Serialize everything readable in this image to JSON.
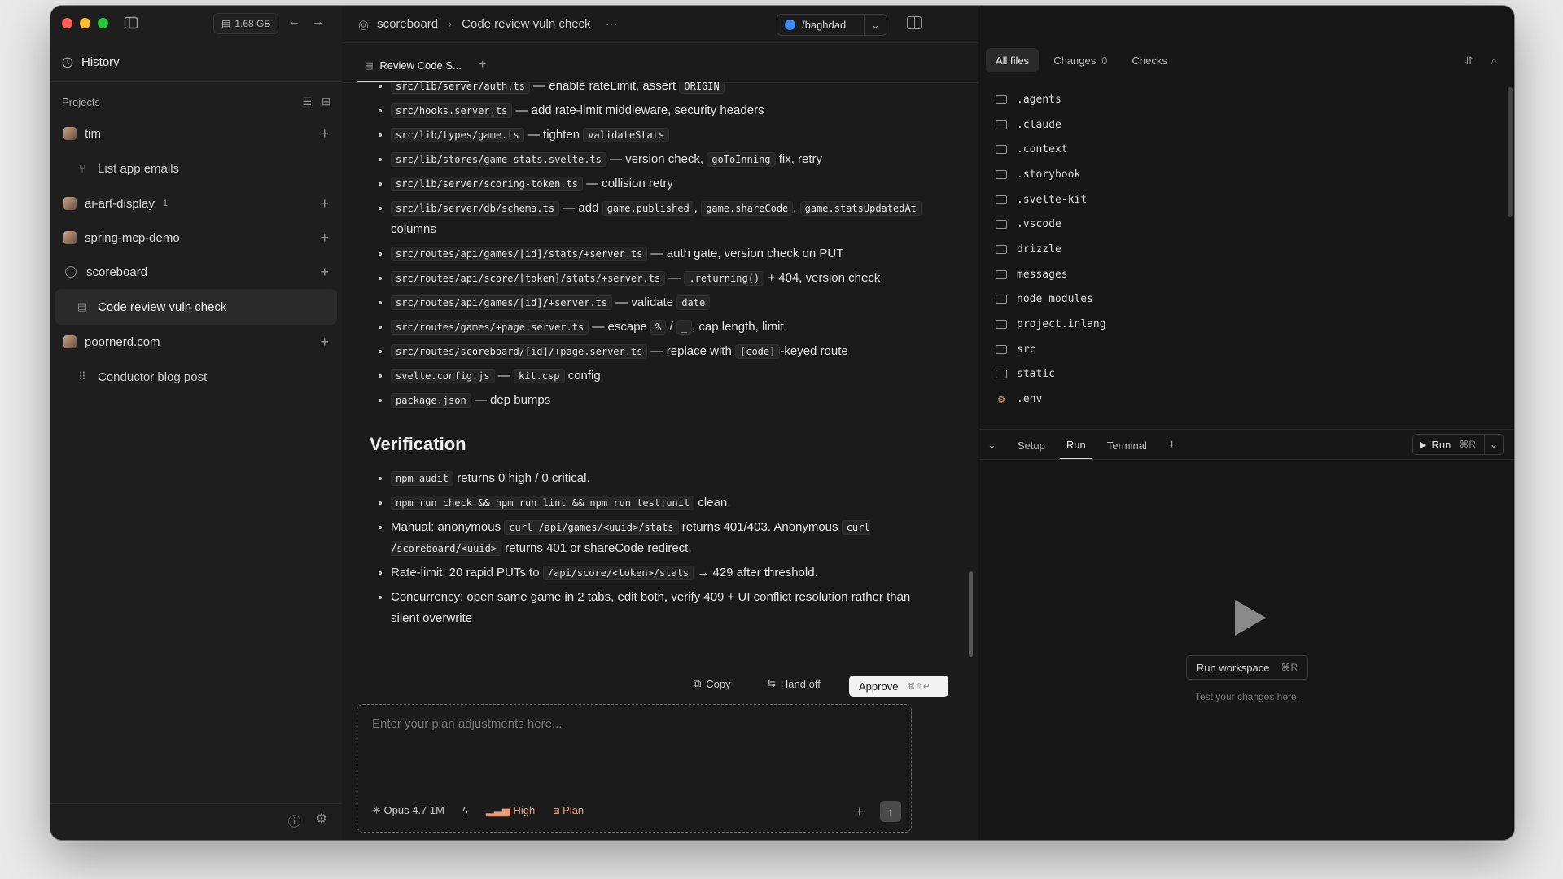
{
  "sidebar": {
    "memory": "1.68 GB",
    "history_label": "History",
    "projects_label": "Projects",
    "projects": [
      {
        "name": "tim",
        "badge": "",
        "children": [
          {
            "label": "List app emails",
            "icon": "branch-icon"
          }
        ]
      },
      {
        "name": "ai-art-display",
        "badge": "1",
        "children": []
      },
      {
        "name": "spring-mcp-demo",
        "badge": "",
        "children": []
      },
      {
        "name": "scoreboard",
        "badge": "",
        "children": [
          {
            "label": "Code review vuln check",
            "icon": "doc-icon",
            "active": true
          }
        ]
      },
      {
        "name": "poornerd.com",
        "badge": "",
        "children": [
          {
            "label": "Conductor blog post",
            "icon": "grid-icon"
          }
        ]
      }
    ]
  },
  "header": {
    "project": "scoreboard",
    "title": "Code review vuln check",
    "branch": "/baghdad"
  },
  "tab": {
    "label": "Review Code S..."
  },
  "plan": {
    "file_items": [
      {
        "code": [
          "src/lib/server/auth.ts",
          "ORIGIN"
        ],
        "text": [
          "— enable rateLimit, assert"
        ]
      },
      {
        "code": [
          "src/hooks.server.ts"
        ],
        "text": [
          "— add rate-limit middleware, security headers"
        ]
      },
      {
        "code": [
          "src/lib/types/game.ts",
          "validateStats"
        ],
        "text": [
          "— tighten"
        ]
      },
      {
        "code": [
          "src/lib/stores/game-stats.svelte.ts",
          "goToInning"
        ],
        "text": [
          "— version check,",
          "fix, retry"
        ]
      },
      {
        "code": [
          "src/lib/server/scoring-token.ts"
        ],
        "text": [
          "— collision retry"
        ]
      },
      {
        "code": [
          "src/lib/server/db/schema.ts",
          "game.published",
          "game.shareCode",
          "game.statsUpdatedAt"
        ],
        "text": [
          "— add",
          ",",
          ",",
          "columns"
        ]
      },
      {
        "code": [
          "src/routes/api/games/[id]/stats/+server.ts"
        ],
        "text": [
          "— auth gate, version check on PUT"
        ]
      },
      {
        "code": [
          "src/routes/api/score/[token]/stats/+server.ts",
          ".returning()"
        ],
        "text": [
          "—",
          "+ 404, version check"
        ]
      },
      {
        "code": [
          "src/routes/api/games/[id]/+server.ts",
          "date"
        ],
        "text": [
          "— validate"
        ]
      },
      {
        "code": [
          "src/routes/games/+page.server.ts",
          "%",
          "_"
        ],
        "text": [
          "— escape",
          "/",
          ", cap length, limit"
        ]
      },
      {
        "code": [
          "src/routes/scoreboard/[id]/+page.server.ts",
          "[code]"
        ],
        "text": [
          "— replace with",
          "-keyed route"
        ]
      },
      {
        "code": [
          "svelte.config.js",
          "kit.csp"
        ],
        "text": [
          "—",
          "config"
        ]
      },
      {
        "code": [
          "package.json"
        ],
        "text": [
          "— dep bumps"
        ]
      }
    ],
    "verification_title": "Verification",
    "verification": [
      {
        "code": [
          "npm audit"
        ],
        "text": [
          "returns 0 high / 0 critical."
        ]
      },
      {
        "code": [
          "npm run check && npm run lint && npm run test:unit"
        ],
        "text": [
          "clean."
        ]
      },
      {
        "code": [
          "curl /api/games/<uuid>/stats",
          "curl /scoreboard/<uuid>"
        ],
        "text": [
          "Manual: anonymous",
          "returns 401/403. Anonymous",
          "returns 401 or shareCode redirect."
        ]
      },
      {
        "code": [
          "/api/score/<token>/stats"
        ],
        "text": [
          "Rate-limit: 20 rapid PUTs to",
          "→ 429 after threshold."
        ]
      },
      {
        "code": [],
        "text": [
          "Concurrency: open same game in 2 tabs, edit both, verify 409 + UI conflict resolution rather than silent overwrite"
        ]
      }
    ]
  },
  "actions": {
    "copy": "Copy",
    "handoff": "Hand off",
    "approve": "Approve",
    "approve_kbd": "⌘⇧↵"
  },
  "composer": {
    "placeholder": "Enter your plan adjustments here...",
    "model": "Opus 4.7 1M",
    "effort": "High",
    "mode": "Plan"
  },
  "files_panel": {
    "tabs": [
      {
        "label": "All files",
        "count": ""
      },
      {
        "label": "Changes",
        "count": "0"
      },
      {
        "label": "Checks",
        "count": ""
      }
    ],
    "files": [
      {
        "name": ".agents",
        "type": "folder"
      },
      {
        "name": ".claude",
        "type": "folder"
      },
      {
        "name": ".context",
        "type": "folder"
      },
      {
        "name": ".storybook",
        "type": "folder"
      },
      {
        "name": ".svelte-kit",
        "type": "folder"
      },
      {
        "name": ".vscode",
        "type": "folder"
      },
      {
        "name": "drizzle",
        "type": "folder"
      },
      {
        "name": "messages",
        "type": "folder"
      },
      {
        "name": "node_modules",
        "type": "folder"
      },
      {
        "name": "project.inlang",
        "type": "folder"
      },
      {
        "name": "src",
        "type": "folder"
      },
      {
        "name": "static",
        "type": "folder"
      },
      {
        "name": ".env",
        "type": "config"
      }
    ]
  },
  "run_panel": {
    "tabs": [
      "Setup",
      "Run",
      "Terminal"
    ],
    "active_tab": "Run",
    "run_label": "Run",
    "run_kbd": "⌘R",
    "workspace_label": "Run workspace",
    "workspace_kbd": "⌘R",
    "hint": "Test your changes here."
  },
  "colors": {
    "accent_effort": "#e8a07c",
    "env_icon": "#d89a4e",
    "branch_globe": "#3d8bff"
  }
}
